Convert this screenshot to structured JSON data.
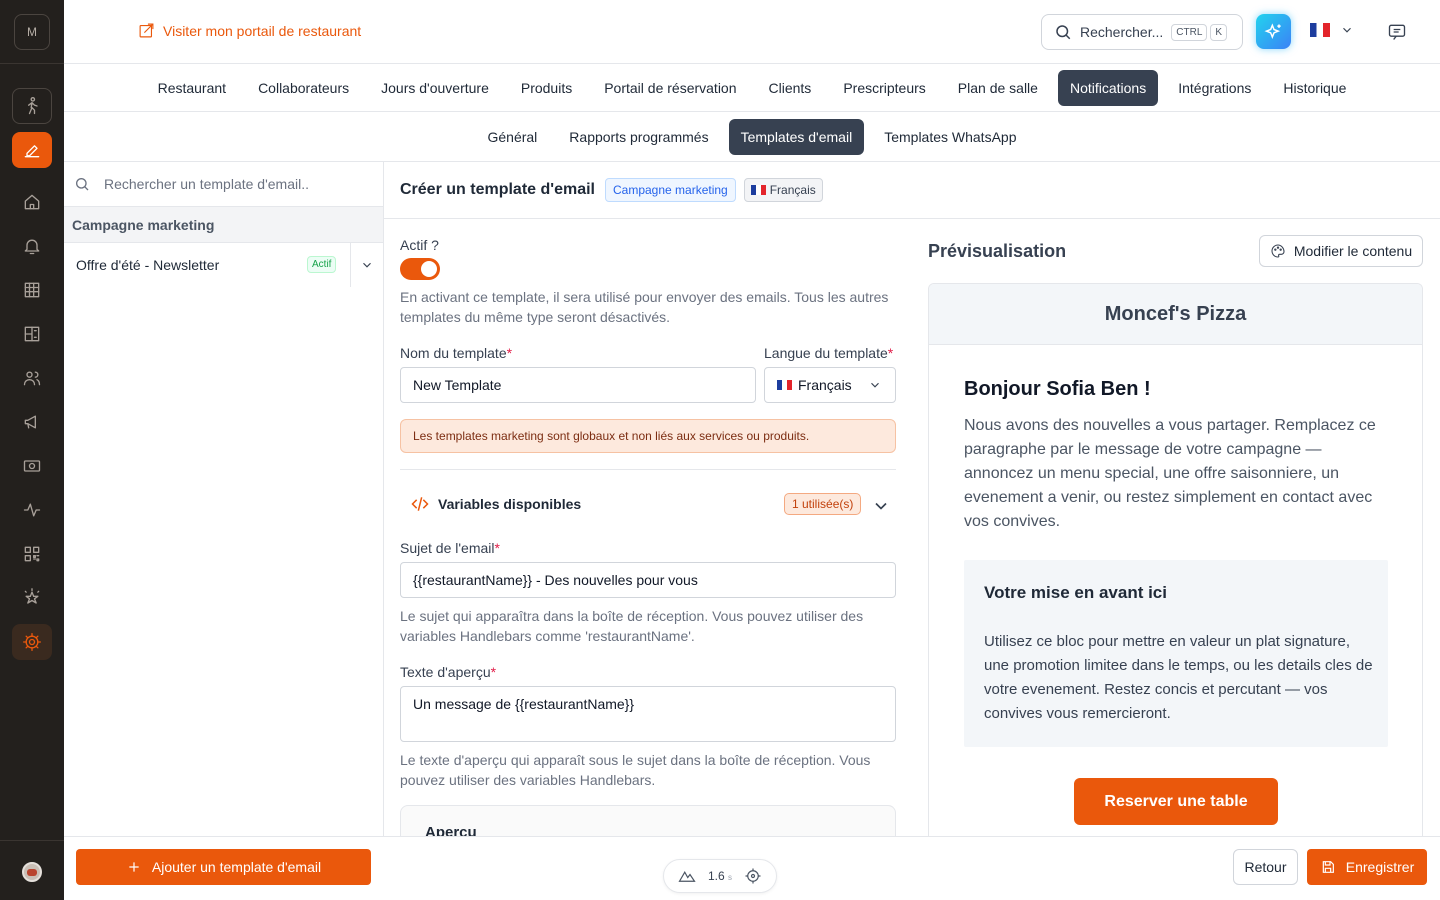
{
  "sidebar": {
    "logo_letter": "M"
  },
  "header": {
    "visit_link": "Visiter mon portail de restaurant",
    "search_placeholder": "Rechercher...",
    "search_kbd_ctrl": "CTRL",
    "search_kbd_k": "K"
  },
  "nav_main": [
    "Restaurant",
    "Collaborateurs",
    "Jours d'ouverture",
    "Produits",
    "Portail de réservation",
    "Clients",
    "Prescripteurs",
    "Plan de salle",
    "Notifications",
    "Intégrations",
    "Historique"
  ],
  "nav_main_active": "Notifications",
  "nav_sub": [
    "Général",
    "Rapports programmés",
    "Templates d'email",
    "Templates WhatsApp"
  ],
  "nav_sub_active": "Templates d'email",
  "left_panel": {
    "search_placeholder": "Rechercher un template d'email..",
    "group_label": "Campagne marketing",
    "item_label": "Offre d'été - Newsletter",
    "item_badge": "Actif",
    "add_button": "Ajouter un template d'email"
  },
  "main": {
    "title": "Créer un template d'email",
    "chip_type": "Campagne marketing",
    "chip_lang": "Français"
  },
  "form": {
    "active_label": "Actif ?",
    "active_value": true,
    "active_help": "En activant ce template, il sera utilisé pour envoyer des emails. Tous les autres templates du même type seront désactivés.",
    "name_label": "Nom du template",
    "name_value": "New Template",
    "lang_label": "Langue du template",
    "lang_value": "Français",
    "warning": "Les templates marketing sont globaux et non liés aux services ou produits.",
    "vars_title": "Variables disponibles",
    "vars_used": "1 utilisée(s)",
    "subject_label": "Sujet de l'email",
    "subject_value": "{{restaurantName}} - Des nouvelles pour vous",
    "subject_help": "Le sujet qui apparaîtra dans la boîte de réception. Vous pouvez utiliser des variables Handlebars comme 'restaurantName'.",
    "preview_text_label": "Texte d'aperçu",
    "preview_text_value": "Un message de {{restaurantName}}",
    "preview_text_help": "Le texte d'aperçu qui apparaît sous le sujet dans la boîte de réception. Vous pouvez utiliser des variables Handlebars.",
    "apercu_label": "Aperçu"
  },
  "preview": {
    "title": "Prévisualisation",
    "modify_button": "Modifier le contenu",
    "restaurant": "Moncef's Pizza",
    "greeting": "Bonjour Sofia Ben !",
    "paragraph": "Nous avons des nouvelles a vous partager. Remplacez ce paragraphe par le message de votre campagne — annoncez un menu special, une offre saisonniere, un evenement a venir, ou restez simplement en contact avec vos convives.",
    "highlight_title": "Votre mise en avant ici",
    "highlight_text": "Utilisez ce bloc pour mettre en valeur un plat signature, une promotion limitee dans le temps, ou les details cles de votre evenement. Restez concis et percutant — vos convives vous remercieront.",
    "cta": "Reserver une table"
  },
  "footer": {
    "perf_value": "1.6",
    "perf_unit": "s",
    "back_button": "Retour",
    "save_button": "Enregistrer"
  },
  "colors": {
    "accent": "#ea580c",
    "active_tab": "#374151",
    "sidebar_bg": "#23201d"
  }
}
